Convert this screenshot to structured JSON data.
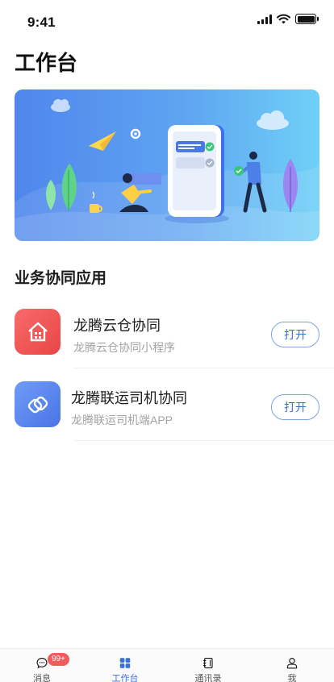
{
  "status_bar": {
    "time": "9:41"
  },
  "page": {
    "title": "工作台"
  },
  "section": {
    "title": "业务协同应用"
  },
  "apps": [
    {
      "name": "龙腾云仓协同",
      "desc": "龙腾云仓协同小程序",
      "action": "打开",
      "icon": "warehouse-icon",
      "color": "#ef5350"
    },
    {
      "name": "龙腾联运司机协同",
      "desc": "龙腾联运司机端APP",
      "action": "打开",
      "icon": "link-icon",
      "color": "#5b84ee"
    }
  ],
  "tabbar": {
    "items": [
      {
        "label": "消息",
        "icon": "chat-icon",
        "badge": "99+"
      },
      {
        "label": "工作台",
        "icon": "grid-icon",
        "active": true
      },
      {
        "label": "通讯录",
        "icon": "contacts-book-icon"
      },
      {
        "label": "我",
        "icon": "user-icon"
      }
    ]
  },
  "colors": {
    "accent": "#3a6fdc",
    "badge": "#f25b5b"
  }
}
